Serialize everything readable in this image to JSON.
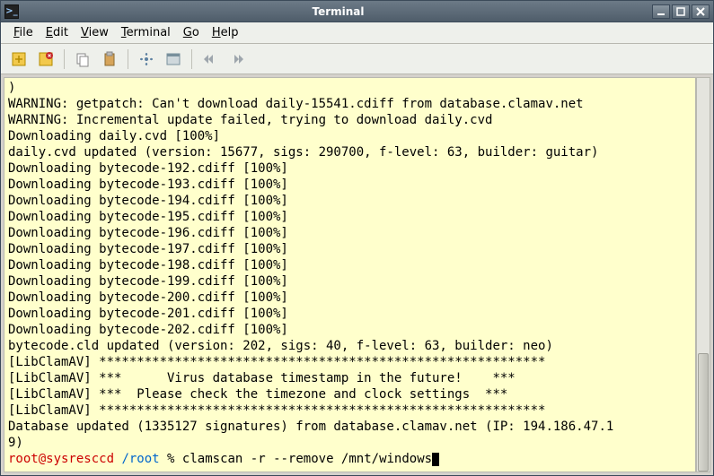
{
  "window": {
    "title": "Terminal"
  },
  "menu": {
    "file": "File",
    "edit": "Edit",
    "view": "View",
    "terminal": "Terminal",
    "go": "Go",
    "help": "Help"
  },
  "terminal": {
    "lines": [
      ")",
      "WARNING: getpatch: Can't download daily-15541.cdiff from database.clamav.net",
      "WARNING: Incremental update failed, trying to download daily.cvd",
      "Downloading daily.cvd [100%]",
      "daily.cvd updated (version: 15677, sigs: 290700, f-level: 63, builder: guitar)",
      "Downloading bytecode-192.cdiff [100%]",
      "Downloading bytecode-193.cdiff [100%]",
      "Downloading bytecode-194.cdiff [100%]",
      "Downloading bytecode-195.cdiff [100%]",
      "Downloading bytecode-196.cdiff [100%]",
      "Downloading bytecode-197.cdiff [100%]",
      "Downloading bytecode-198.cdiff [100%]",
      "Downloading bytecode-199.cdiff [100%]",
      "Downloading bytecode-200.cdiff [100%]",
      "Downloading bytecode-201.cdiff [100%]",
      "Downloading bytecode-202.cdiff [100%]",
      "bytecode.cld updated (version: 202, sigs: 40, f-level: 63, builder: neo)",
      "[LibClamAV] ***********************************************************",
      "[LibClamAV] ***      Virus database timestamp in the future!    ***",
      "[LibClamAV] ***  Please check the timezone and clock settings  ***",
      "[LibClamAV] ***********************************************************",
      "Database updated (1335127 signatures) from database.clamav.net (IP: 194.186.47.1",
      "9)"
    ],
    "prompt": {
      "user_host": "root@sysresccd",
      "path": "/root",
      "symbol": "%",
      "command": "clamscan -r --remove /mnt/windows"
    }
  }
}
